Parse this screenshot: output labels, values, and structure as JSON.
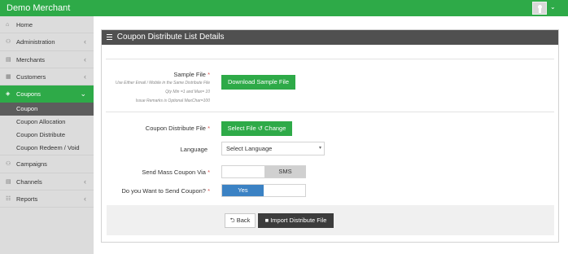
{
  "header": {
    "brand": "Demo Merchant",
    "caret": "⌄"
  },
  "sidebar": {
    "items": [
      {
        "label": "Home",
        "icon": "home-icon",
        "glyph": "⌂",
        "chevron": ""
      },
      {
        "label": "Administration",
        "icon": "users-icon",
        "glyph": "⚇",
        "chevron": "‹"
      },
      {
        "label": "Merchants",
        "icon": "merchants-icon",
        "glyph": "▤",
        "chevron": "‹"
      },
      {
        "label": "Customers",
        "icon": "customers-icon",
        "glyph": "▦",
        "chevron": "‹"
      },
      {
        "label": "Coupons",
        "icon": "coupon-icon",
        "glyph": "◈",
        "chevron": "⌄"
      }
    ],
    "sub_items": [
      "Coupon",
      "Coupon Allocation",
      "Coupon Distribute",
      "Coupon Redeem / Void"
    ],
    "items_after": [
      {
        "label": "Campaigns",
        "icon": "campaign-icon",
        "glyph": "⚇",
        "chevron": ""
      },
      {
        "label": "Channels",
        "icon": "channels-icon",
        "glyph": "▤",
        "chevron": "‹"
      },
      {
        "label": "Reports",
        "icon": "cart-icon",
        "glyph": "☷",
        "chevron": "‹"
      }
    ]
  },
  "panel": {
    "title": "Coupon Distribute List Details",
    "sample_file": {
      "label": "Sample File",
      "req": "*",
      "hint1": "Use Either Email / Mobile in the Same Distribute File",
      "hint2": "Qty Min =1 and Max= 10",
      "hint3": "Issue Remarks is Optional MaxChar=100",
      "button": "Download Sample File"
    },
    "coupon_file": {
      "label": "Coupon Distribute File",
      "req": "*",
      "select_label": "Select File",
      "change_label": "↺ Change"
    },
    "language": {
      "label": "Language",
      "value": "Select Language",
      "arrow": "▾"
    },
    "mass_coupon": {
      "label": "Send Mass Coupon Via",
      "req": "*",
      "option_left": "",
      "option_right": "SMS"
    },
    "send_coupon": {
      "label": "Do you Want to Send Coupon?",
      "req": "*",
      "option_left": "Yes",
      "option_right": ""
    },
    "buttons": {
      "back": "⮌ Back",
      "import": "■ Import Distribute File"
    }
  },
  "colors": {
    "brand_green": "#2eaa48",
    "panel_header": "#505050",
    "toggle_blue": "#3b82c4"
  }
}
